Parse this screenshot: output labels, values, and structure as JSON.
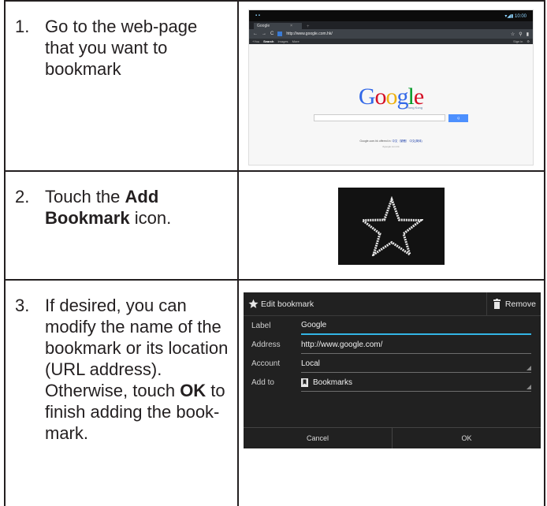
{
  "steps": [
    {
      "num": "1.",
      "text": "Go to the web-page that you want to bookmark"
    },
    {
      "num": "2.",
      "text_before": "Touch the ",
      "bold": "Add Bookmark",
      "text_after": " icon."
    },
    {
      "num": "3.",
      "text_before": "If desired, you can modify the name of the bookmark or its location (URL address). Otherwise, touch ",
      "bold": "OK",
      "text_after": " to finish adding the book-mark."
    }
  ],
  "browser": {
    "tab_title": "Google",
    "tab_close": "×",
    "new_tab": "+",
    "url": "http://www.google.com.hk/",
    "nav_items": [
      "+You",
      "Search",
      "Images",
      "More"
    ],
    "sign_in": "Sign in",
    "logo_sub": "Hong Kong",
    "search_button": "Q",
    "offered_text": "Google.com.hk offered in:",
    "offered_langs": "中文（繁體） 中文(简体)",
    "domain_text": "#google.com.hk"
  },
  "logo_letters": [
    {
      "char": "G",
      "color": "#3369e8"
    },
    {
      "char": "o",
      "color": "#d50f25"
    },
    {
      "char": "o",
      "color": "#eeb211"
    },
    {
      "char": "g",
      "color": "#3369e8"
    },
    {
      "char": "l",
      "color": "#009925"
    },
    {
      "char": "e",
      "color": "#d50f25"
    }
  ],
  "dialog": {
    "title": "Edit bookmark",
    "remove": "Remove",
    "fields": [
      {
        "label": "Label",
        "value": "Google"
      },
      {
        "label": "Address",
        "value": "http://www.google.com/"
      },
      {
        "label": "Account",
        "value": "Local"
      },
      {
        "label": "Add to",
        "value": "Bookmarks"
      }
    ],
    "cancel": "Cancel",
    "ok": "OK"
  },
  "colors": {
    "accent": "#33b5e5",
    "dialog_bg": "#212121",
    "google_button": "#4d90fe"
  },
  "icons": [
    "star-icon",
    "trash-icon",
    "bookmark-folder-icon",
    "reload-icon",
    "menu-icon"
  ]
}
